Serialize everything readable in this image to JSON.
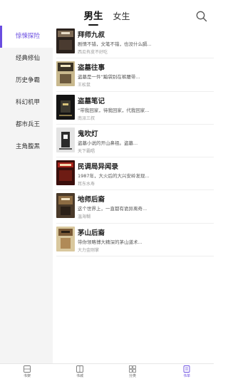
{
  "header": {
    "tabs": [
      {
        "label": "男生",
        "active": true
      },
      {
        "label": "女生",
        "active": false
      }
    ],
    "search_icon": "search-icon"
  },
  "sidebar": {
    "items": [
      {
        "label": "惊悚探险",
        "active": true
      },
      {
        "label": "经典修仙",
        "active": false
      },
      {
        "label": "历史争霸",
        "active": false
      },
      {
        "label": "科幻机甲",
        "active": false
      },
      {
        "label": "都市兵王",
        "active": false
      },
      {
        "label": "主角腹黑",
        "active": false
      }
    ]
  },
  "books": [
    {
      "title": "拜师九叔",
      "desc": "剧情不错，文笔不错，也没什么膈...",
      "author": "西瓜有皮不好吃"
    },
    {
      "title": "盗墓往事",
      "desc": "盗墓是一件“黯袋别在裤腰带...",
      "author": "王松鼠"
    },
    {
      "title": "盗墓笔记",
      "desc": "“带我回家，待我回家，代我回家...",
      "author": "南派三叔"
    },
    {
      "title": "鬼吹灯",
      "desc": "盗墓小说的开山鼻祖。盗墓...",
      "author": "天下霸唱"
    },
    {
      "title": "民调局异闻录",
      "desc": "1987年，大火后的大兴安岭发现...",
      "author": "耳东水寿"
    },
    {
      "title": "地师后裔",
      "desc": "这个世界上，一直都有诡异离奇...",
      "author": "温海糊"
    },
    {
      "title": "茅山后裔",
      "desc": "带你领略博大精深的茅山道术...",
      "author": "大力金刚掌"
    }
  ],
  "bottom_nav": {
    "items": [
      {
        "label": "书架",
        "icon": "bookshelf-icon",
        "active": false
      },
      {
        "label": "书城",
        "icon": "bookstore-icon",
        "active": false
      },
      {
        "label": "分类",
        "icon": "category-icon",
        "active": false
      },
      {
        "label": "书单",
        "icon": "booklist-icon",
        "active": true
      }
    ]
  },
  "colors": {
    "accent": "#6a4de0",
    "sidebar_bg": "#f4f4f4",
    "divider": "#eeeeee"
  }
}
